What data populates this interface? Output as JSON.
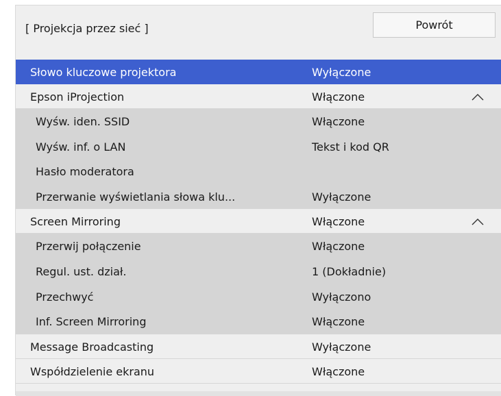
{
  "header": {
    "title": "[ Projekcja przez sieć ]",
    "back_label": "Powrót"
  },
  "rows": [
    {
      "label": "Słowo kluczowe projektora",
      "value": "Wyłączone"
    },
    {
      "label": "Epson iProjection",
      "value": "Włączone",
      "expanded_icon": "chevron-up-icon"
    },
    {
      "label": "Wyśw. iden. SSID",
      "value": "Włączone"
    },
    {
      "label": "Wyśw. inf. o LAN",
      "value": "Tekst i kod QR"
    },
    {
      "label": "Hasło moderatora",
      "value": ""
    },
    {
      "label": "Przerwanie wyświetlania słowa klu...",
      "value": "Wyłączone"
    },
    {
      "label": "Screen Mirroring",
      "value": "Włączone",
      "expanded_icon": "chevron-up-icon"
    },
    {
      "label": "Przerwij połączenie",
      "value": "Włączone"
    },
    {
      "label": "Regul. ust. dział.",
      "value": "1 (Dokładnie)"
    },
    {
      "label": "Przechwyć",
      "value": "Wyłączono"
    },
    {
      "label": "Inf. Screen Mirroring",
      "value": "Włączone"
    },
    {
      "label": "Message Broadcasting",
      "value": "Wyłączone"
    },
    {
      "label": "Współdzielenie ekranu",
      "value": "Włączone"
    }
  ],
  "colors": {
    "selection": "#3d5fcf",
    "panel": "#efefef",
    "sub_item": "#d5d5d5"
  }
}
